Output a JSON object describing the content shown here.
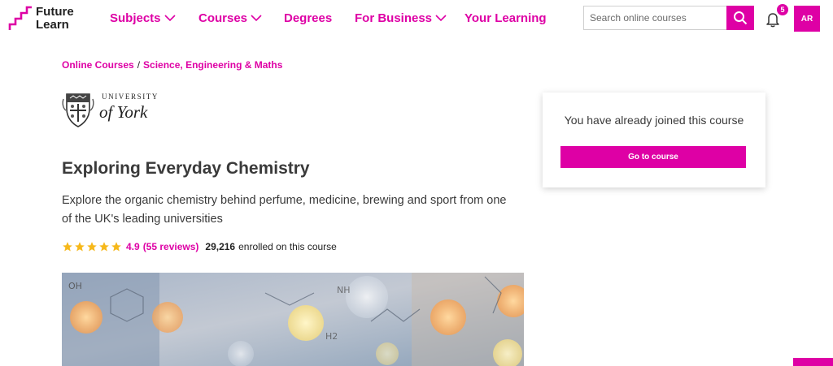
{
  "header": {
    "logo_line1": "Future",
    "logo_line2": "Learn",
    "nav": [
      {
        "label": "Subjects",
        "has_dropdown": true
      },
      {
        "label": "Courses",
        "has_dropdown": true
      },
      {
        "label": "Degrees",
        "has_dropdown": false
      },
      {
        "label": "For Business",
        "has_dropdown": true
      },
      {
        "label": "Your Learning",
        "has_dropdown": false
      }
    ],
    "search_placeholder": "Search online courses",
    "notification_count": "5",
    "avatar_initials": "AR"
  },
  "breadcrumb": {
    "items": [
      "Online Courses",
      "Science, Engineering & Maths"
    ],
    "separator": "/"
  },
  "university": {
    "line1": "UNIVERSITY",
    "line2": "of York"
  },
  "course": {
    "title": "Exploring Everyday Chemistry",
    "description": "Explore the organic chemistry behind perfume, medicine, brewing and sport from one of the UK's leading universities",
    "rating": 4.9,
    "rating_label": "4.9",
    "reviews_label": "(55 reviews)",
    "enrolled_count": "29,216",
    "enrolled_text": "enrolled on this course"
  },
  "join_card": {
    "message": "You have already joined this course",
    "button_label": "Go to course"
  },
  "colors": {
    "brand": "#de00a5",
    "star": "#f6b81a",
    "text": "#3a3a3a"
  },
  "icons": {
    "search": "search-icon",
    "bell": "bell-icon",
    "chevron": "chevron-down-icon",
    "star": "star-icon"
  }
}
